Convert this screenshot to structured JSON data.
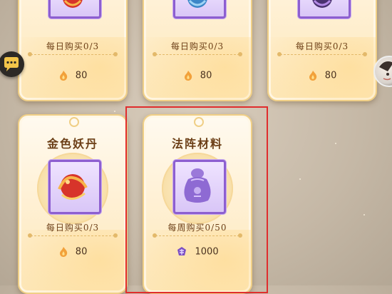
{
  "shop_cards": [
    {
      "title": "",
      "limit_text": "每日购买0/3",
      "currency_icon": "flame-coin-icon",
      "price": "80",
      "item_icon": "red-orb-icon"
    },
    {
      "title": "",
      "limit_text": "每日购买0/3",
      "currency_icon": "flame-coin-icon",
      "price": "80",
      "item_icon": "blue-orb-icon"
    },
    {
      "title": "",
      "limit_text": "每日购买0/3",
      "currency_icon": "flame-coin-icon",
      "price": "80",
      "item_icon": "purple-orb-icon"
    },
    {
      "title": "金色妖丹",
      "limit_text": "每日购买0/3",
      "currency_icon": "flame-coin-icon",
      "price": "80",
      "item_icon": "golden-demon-pill-icon"
    },
    {
      "title": "法阵材料",
      "limit_text": "每周购买0/50",
      "currency_icon": "purple-token-icon",
      "price": "1000",
      "item_icon": "purple-pouch-icon"
    }
  ],
  "colors": {
    "highlight_border": "#e02d2d",
    "card_border": "#f0cf86",
    "item_frame": "#8d5fd0",
    "text": "#6b3e16"
  }
}
